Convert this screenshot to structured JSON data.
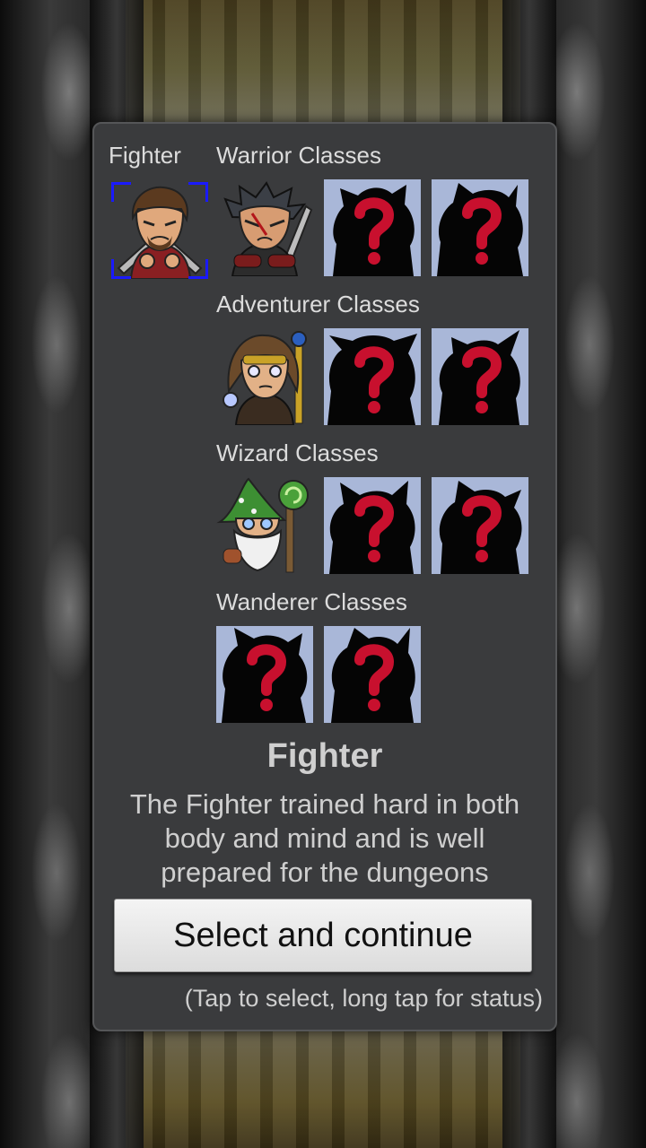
{
  "selected_class_header": "Fighter",
  "categories": {
    "warrior": "Warrior Classes",
    "adventurer": "Adventurer Classes",
    "wizard": "Wizard Classes",
    "wanderer": "Wanderer Classes"
  },
  "icons": {
    "selected": "fighter-portrait",
    "warrior_unlocked": "warrior-portrait",
    "adventurer_unlocked": "adventurer-portrait",
    "wizard_unlocked": "wizard-portrait",
    "locked": "question-mark-silhouette"
  },
  "selection": {
    "title": "Fighter",
    "description": "The Fighter trained hard in both body and mind and is well prepared for the dungeons"
  },
  "button": {
    "label": "Select and continue"
  },
  "hint": "(Tap to select, long tap for status)",
  "colors": {
    "panel": "#3a3b3d",
    "locked_bg": "#a9b7d8",
    "question_mark": "#c8102e",
    "selection_border": "#1a1aff"
  }
}
